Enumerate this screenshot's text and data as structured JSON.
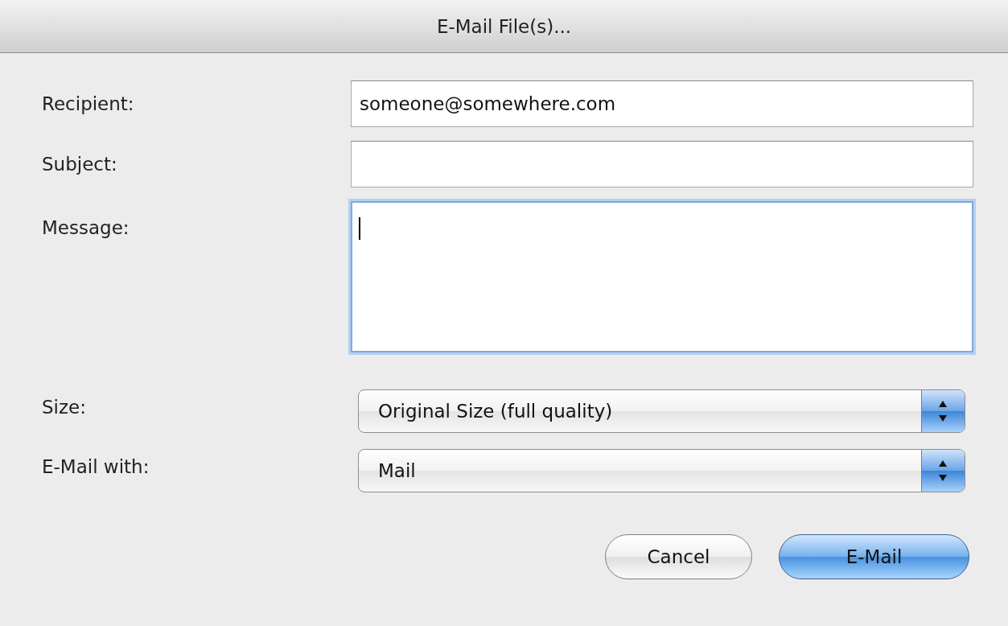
{
  "window": {
    "title": "E-Mail File(s)..."
  },
  "fields": [
    {
      "kind": "line",
      "label": "Recipient:",
      "value": "someone@somewhere.com",
      "focused": false
    },
    {
      "kind": "line",
      "label": "Subject:",
      "focused": false
    },
    {
      "kind": "multiline",
      "label": "Message:",
      "focused": true
    }
  ],
  "popups": [
    {
      "label": "Size:",
      "value": "Original Size (full quality)"
    },
    {
      "label": "E-Mail with:",
      "value": "Mail"
    }
  ],
  "buttons": [
    {
      "label": "Cancel",
      "default": false
    },
    {
      "label": "E-Mail",
      "default": true
    }
  ]
}
